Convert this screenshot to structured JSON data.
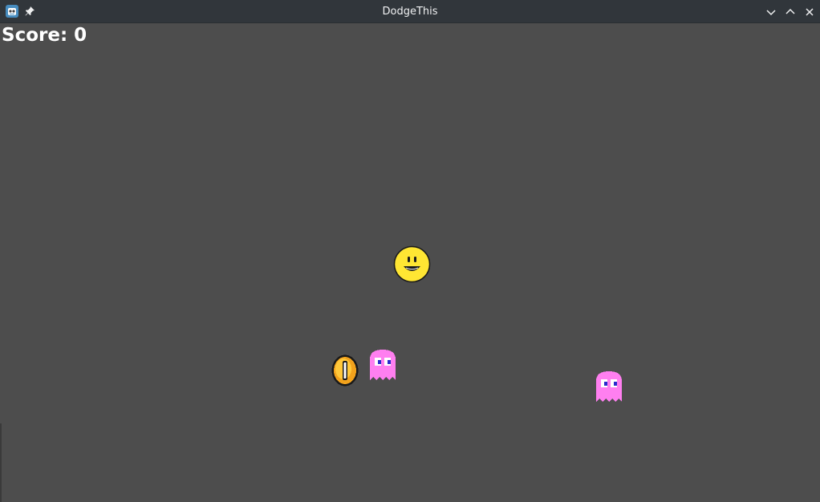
{
  "window": {
    "title": "DodgeThis",
    "app_icon": "godot-engine-icon",
    "pin_icon": "pin-icon",
    "controls": [
      "minimize-icon",
      "maximize-icon",
      "close-icon"
    ],
    "titlebar_color": "#31363b",
    "title_color": "#eff0f1"
  },
  "game": {
    "background_color": "#4d4d4d",
    "score_label": "Score: 0",
    "entities": [
      {
        "type": "player",
        "icon": "smiley-face-icon",
        "color": "#ffe633"
      },
      {
        "type": "coin",
        "icon": "coin-icon",
        "color": "#f2a21c"
      },
      {
        "type": "enemy",
        "icon": "pink-ghost-icon",
        "color": "#ff7ff0"
      },
      {
        "type": "enemy",
        "icon": "pink-ghost-icon",
        "color": "#ff7ff0"
      }
    ]
  }
}
